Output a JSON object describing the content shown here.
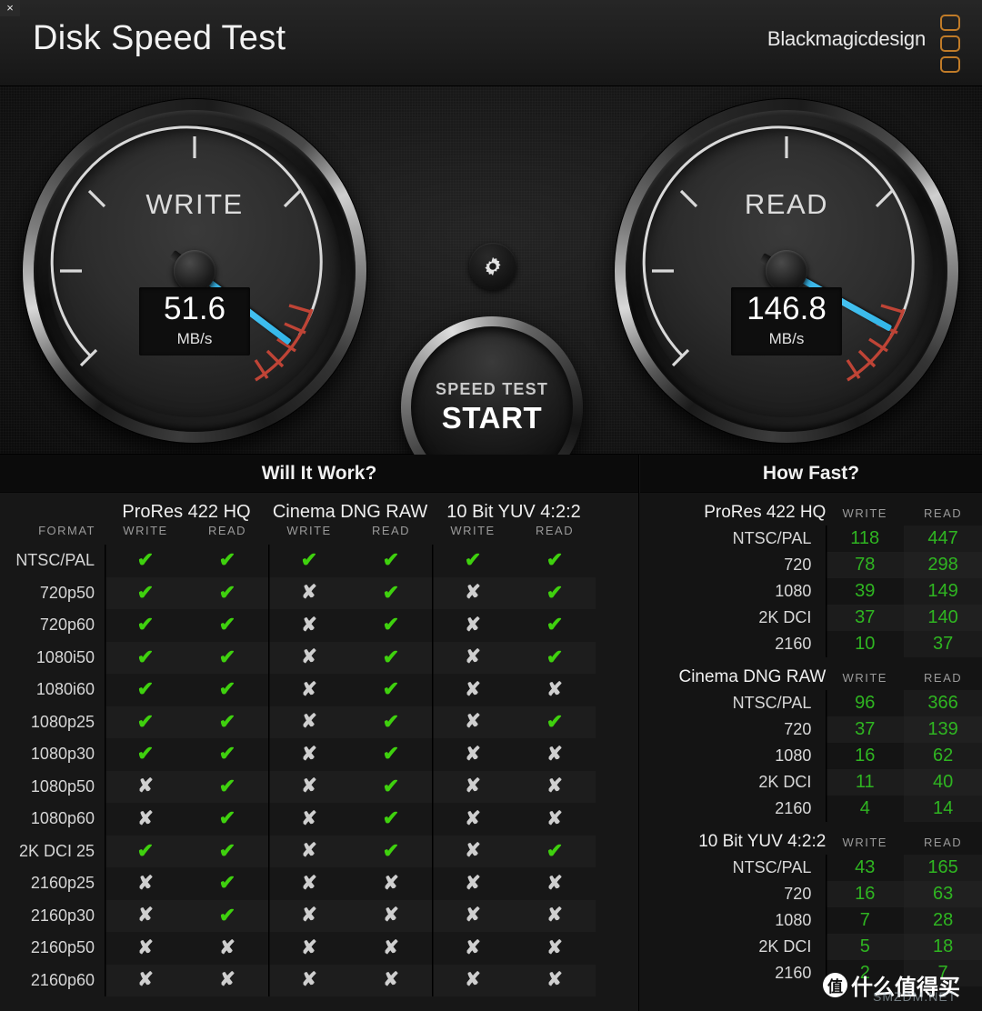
{
  "window": {
    "close_label": "×"
  },
  "header": {
    "title": "Disk Speed Test",
    "brand": "Blackmagicdesign",
    "brand_color": "#c07b28"
  },
  "gauges": {
    "write": {
      "label": "WRITE",
      "value": "51.6",
      "unit": "MB/s",
      "needle_deg": 217,
      "icon": "speedometer-icon"
    },
    "read": {
      "label": "READ",
      "value": "146.8",
      "unit": "MB/s",
      "needle_deg": 209,
      "icon": "speedometer-icon"
    },
    "needle_color": "#3fb8e8",
    "redzone_color": "#c0392b"
  },
  "controls": {
    "settings_icon": "gear-icon",
    "start_line1": "SPEED TEST",
    "start_line2": "START"
  },
  "will_it_work": {
    "title": "Will It Work?",
    "format_header": "FORMAT",
    "codecs": [
      "ProRes 422 HQ",
      "Cinema DNG RAW",
      "10 Bit YUV 4:2:2"
    ],
    "sub_headers": [
      "WRITE",
      "READ"
    ],
    "ok_glyph": "✔",
    "no_glyph": "✘",
    "ok_color": "#3fd10e",
    "no_color": "#cfcfcf",
    "rows": [
      {
        "format": "NTSC/PAL",
        "cells": [
          true,
          true,
          true,
          true,
          true,
          true
        ]
      },
      {
        "format": "720p50",
        "cells": [
          true,
          true,
          false,
          true,
          false,
          true
        ]
      },
      {
        "format": "720p60",
        "cells": [
          true,
          true,
          false,
          true,
          false,
          true
        ]
      },
      {
        "format": "1080i50",
        "cells": [
          true,
          true,
          false,
          true,
          false,
          true
        ]
      },
      {
        "format": "1080i60",
        "cells": [
          true,
          true,
          false,
          true,
          false,
          false
        ]
      },
      {
        "format": "1080p25",
        "cells": [
          true,
          true,
          false,
          true,
          false,
          true
        ]
      },
      {
        "format": "1080p30",
        "cells": [
          true,
          true,
          false,
          true,
          false,
          false
        ]
      },
      {
        "format": "1080p50",
        "cells": [
          false,
          true,
          false,
          true,
          false,
          false
        ]
      },
      {
        "format": "1080p60",
        "cells": [
          false,
          true,
          false,
          true,
          false,
          false
        ]
      },
      {
        "format": "2K DCI 25",
        "cells": [
          true,
          true,
          false,
          true,
          false,
          true
        ]
      },
      {
        "format": "2160p25",
        "cells": [
          false,
          true,
          false,
          false,
          false,
          false
        ]
      },
      {
        "format": "2160p30",
        "cells": [
          false,
          true,
          false,
          false,
          false,
          false
        ]
      },
      {
        "format": "2160p50",
        "cells": [
          false,
          false,
          false,
          false,
          false,
          false
        ]
      },
      {
        "format": "2160p60",
        "cells": [
          false,
          false,
          false,
          false,
          false,
          false
        ]
      }
    ]
  },
  "how_fast": {
    "title": "How Fast?",
    "value_color": "#2fb521",
    "sub_headers": [
      "WRITE",
      "READ"
    ],
    "groups": [
      {
        "name": "ProRes 422 HQ",
        "rows": [
          {
            "format": "NTSC/PAL",
            "write": "118",
            "read": "447"
          },
          {
            "format": "720",
            "write": "78",
            "read": "298"
          },
          {
            "format": "1080",
            "write": "39",
            "read": "149"
          },
          {
            "format": "2K DCI",
            "write": "37",
            "read": "140"
          },
          {
            "format": "2160",
            "write": "10",
            "read": "37"
          }
        ]
      },
      {
        "name": "Cinema DNG RAW",
        "rows": [
          {
            "format": "NTSC/PAL",
            "write": "96",
            "read": "366"
          },
          {
            "format": "720",
            "write": "37",
            "read": "139"
          },
          {
            "format": "1080",
            "write": "16",
            "read": "62"
          },
          {
            "format": "2K DCI",
            "write": "11",
            "read": "40"
          },
          {
            "format": "2160",
            "write": "4",
            "read": "14"
          }
        ]
      },
      {
        "name": "10 Bit YUV 4:2:2",
        "rows": [
          {
            "format": "NTSC/PAL",
            "write": "43",
            "read": "165"
          },
          {
            "format": "720",
            "write": "16",
            "read": "63"
          },
          {
            "format": "1080",
            "write": "7",
            "read": "28"
          },
          {
            "format": "2K DCI",
            "write": "5",
            "read": "18"
          },
          {
            "format": "2160",
            "write": "2",
            "read": "7"
          }
        ]
      }
    ]
  },
  "watermark": {
    "badge": "值",
    "text": "什么值得买",
    "sub": "SMZDM.NET"
  }
}
